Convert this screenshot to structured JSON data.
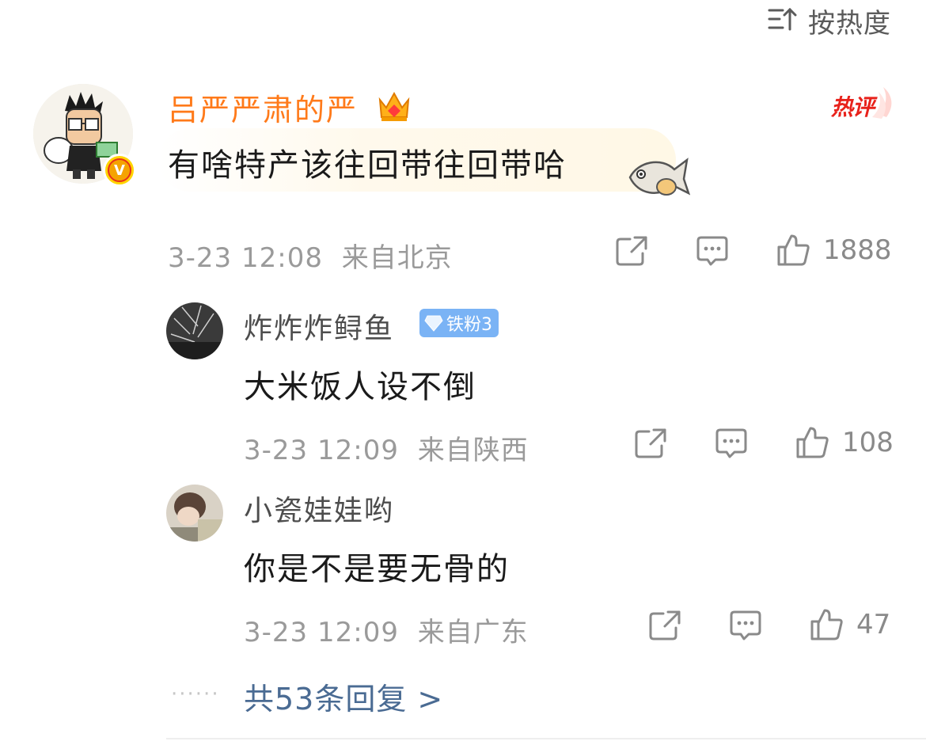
{
  "sort": {
    "icon": "sort-icon",
    "label": "按热度"
  },
  "main_comment": {
    "username": "吕严严肃的严",
    "username_color": "#ff7a1a",
    "badge_icon": "crown-icon",
    "hot_tag": "热评",
    "text": "有啥特产该往回带往回带哈",
    "verified_icon": "verified-v-icon",
    "timestamp": "3-23 12:08",
    "location": "来自北京",
    "likes": "1888"
  },
  "replies": [
    {
      "username": "炸炸炸鲟鱼",
      "fan_badge": "铁粉3",
      "text": "大米饭人设不倒",
      "timestamp": "3-23 12:09",
      "location": "来自陕西",
      "likes": "108"
    },
    {
      "username": "小瓷娃娃哟",
      "text": "你是不是要无骨的",
      "timestamp": "3-23 12:09",
      "location": "来自广东",
      "likes": "47"
    }
  ],
  "more_replies": {
    "dots": "······",
    "label": "共53条回复 >"
  },
  "colors": {
    "accent_link": "#4a6b93",
    "meta": "#9a9a9a",
    "hot": "#e8221b",
    "fan_badge": "#7ab3f5"
  }
}
